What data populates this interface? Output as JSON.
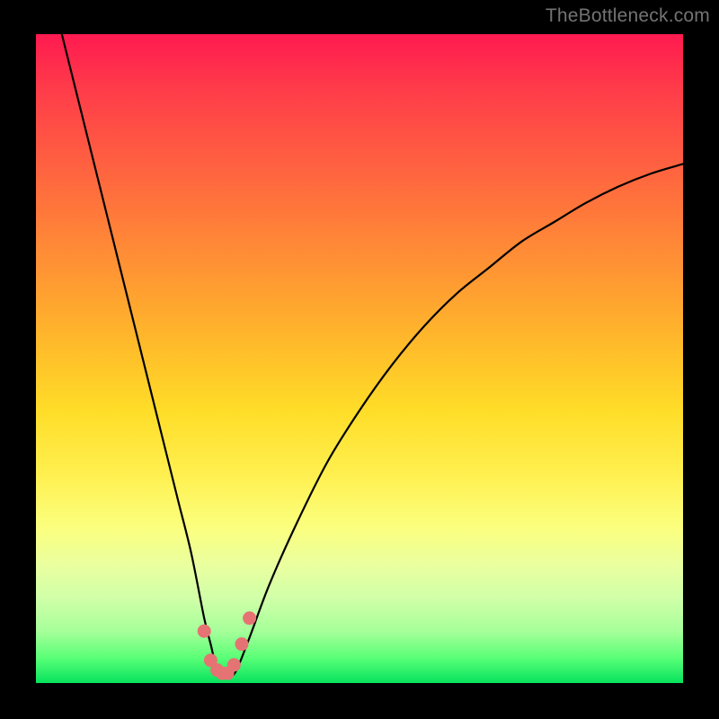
{
  "watermark": "TheBottleneck.com",
  "chart_data": {
    "type": "line",
    "title": "",
    "xlabel": "",
    "ylabel": "",
    "xlim": [
      0,
      100
    ],
    "ylim": [
      0,
      100
    ],
    "series": [
      {
        "name": "bottleneck-curve",
        "x": [
          4,
          6,
          8,
          10,
          12,
          14,
          16,
          18,
          20,
          22,
          24,
          26,
          27,
          28,
          29,
          30,
          31,
          33,
          36,
          40,
          45,
          50,
          55,
          60,
          65,
          70,
          75,
          80,
          85,
          90,
          95,
          100
        ],
        "values": [
          100,
          92,
          84,
          76,
          68,
          60,
          52,
          44,
          36,
          28,
          20,
          10,
          6,
          2,
          1,
          1,
          2,
          7,
          15,
          24,
          34,
          42,
          49,
          55,
          60,
          64,
          68,
          71,
          74,
          76.5,
          78.5,
          80
        ]
      }
    ],
    "markers": [
      {
        "x": 26.0,
        "y": 8.0
      },
      {
        "x": 27.0,
        "y": 3.5
      },
      {
        "x": 28.0,
        "y": 2.0
      },
      {
        "x": 28.8,
        "y": 1.5
      },
      {
        "x": 29.6,
        "y": 1.5
      },
      {
        "x": 30.6,
        "y": 2.8
      },
      {
        "x": 31.8,
        "y": 6.0
      },
      {
        "x": 33.0,
        "y": 10.0
      }
    ],
    "gradient_bands": [
      {
        "color": "#ff1a50",
        "pos": 0
      },
      {
        "color": "#ffdd28",
        "pos": 58
      },
      {
        "color": "#fbff7e",
        "pos": 76
      },
      {
        "color": "#07e35e",
        "pos": 100
      }
    ]
  }
}
